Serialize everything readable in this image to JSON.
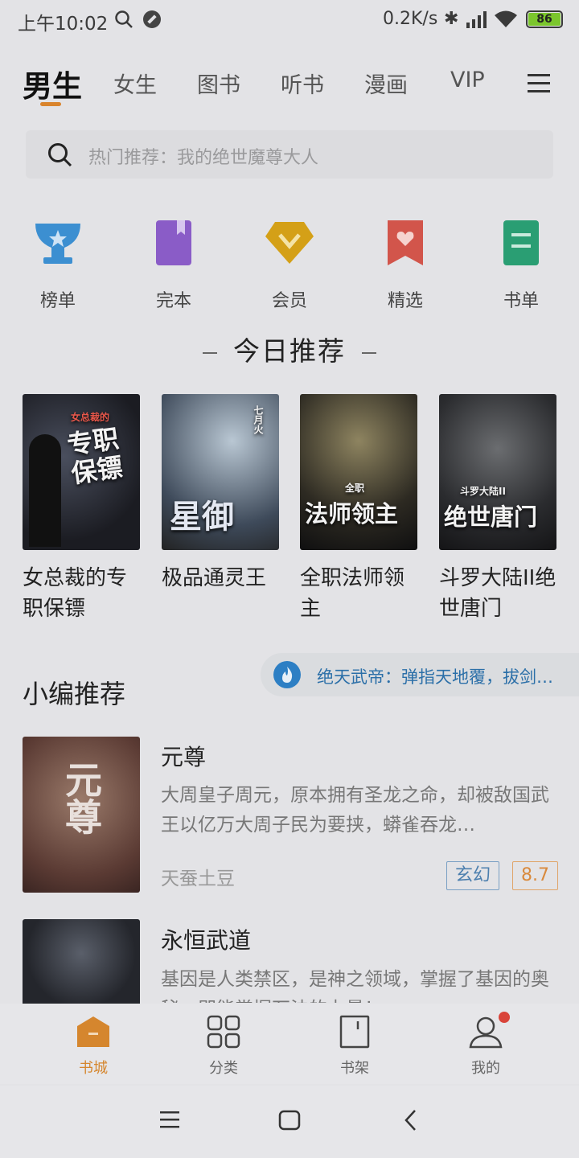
{
  "status_bar": {
    "time": "上午10:02",
    "speed": "0.2K/s",
    "battery": "86"
  },
  "tabs": [
    "男生",
    "女生",
    "图书",
    "听书",
    "漫画",
    "VIP"
  ],
  "search": {
    "placeholder": "热门推荐：我的绝世魔尊大人"
  },
  "quick_entries": [
    {
      "label": "榜单",
      "icon": "trophy-icon"
    },
    {
      "label": "完本",
      "icon": "book-icon"
    },
    {
      "label": "会员",
      "icon": "diamond-icon"
    },
    {
      "label": "精选",
      "icon": "heart-bookmark-icon"
    },
    {
      "label": "书单",
      "icon": "list-icon"
    }
  ],
  "today": {
    "title": "今日推荐",
    "books": [
      {
        "name": "女总裁的专职保镖",
        "cover_text": "专职保镖",
        "cover_sub": "女总裁的"
      },
      {
        "name": "极品通灵王",
        "cover_text": "星御",
        "cover_sub": "七月火"
      },
      {
        "name": "全职法师领主",
        "cover_text": "法师领主",
        "cover_sub": "全职"
      },
      {
        "name": "斗罗大陆II绝世唐门",
        "cover_text": "绝世唐门",
        "cover_sub": "斗罗大陆II"
      }
    ]
  },
  "editor": {
    "title": "小编推荐",
    "banner": "绝天武帝：弹指天地覆，拔剑…",
    "items": [
      {
        "title": "元尊",
        "desc": "大周皇子周元，原本拥有圣龙之命，却被敌国武王以亿万大周子民为要挟，蟒雀吞龙…",
        "author": "天蚕土豆",
        "tag": "玄幻",
        "score": "8.7",
        "cover_text": "元尊"
      },
      {
        "title": "永恒武道",
        "desc": "基因是人类禁区，是神之领域，掌握了基因的奥秘，即能掌握万法的力量！……",
        "cover_text": ""
      }
    ]
  },
  "bottom_nav": [
    "书城",
    "分类",
    "书架",
    "我的"
  ]
}
